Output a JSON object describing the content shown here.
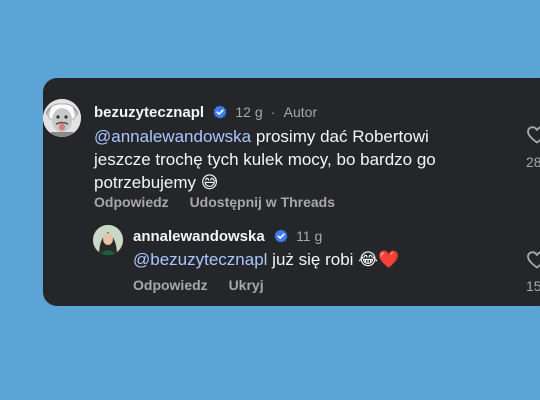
{
  "comment": {
    "username": "bezuzytecznapl",
    "time": "12 g",
    "author_badge": "Autor",
    "mention": "@annalewandowska",
    "text": " prosimy dać Robertowi jeszcze trochę tych kulek mocy, bo bardzo go potrzebujemy ",
    "emoji": "😅",
    "actions": {
      "reply": "Odpowiedz",
      "share": "Udostępnij w Threads"
    },
    "likes": "28"
  },
  "reply": {
    "username": "annalewandowska",
    "time": "11 g",
    "mention": "@bezuzytecznapl",
    "text": " już się robi ",
    "emoji": "😂❤️",
    "actions": {
      "reply": "Odpowiedz",
      "hide": "Ukryj"
    },
    "likes": "15"
  },
  "colors": {
    "background": "#5da4d6",
    "card": "#25262a",
    "mention": "#a9c7ff",
    "verified": "#3f7bf5"
  },
  "icons": [
    "verified-badge-icon",
    "heart-icon"
  ]
}
